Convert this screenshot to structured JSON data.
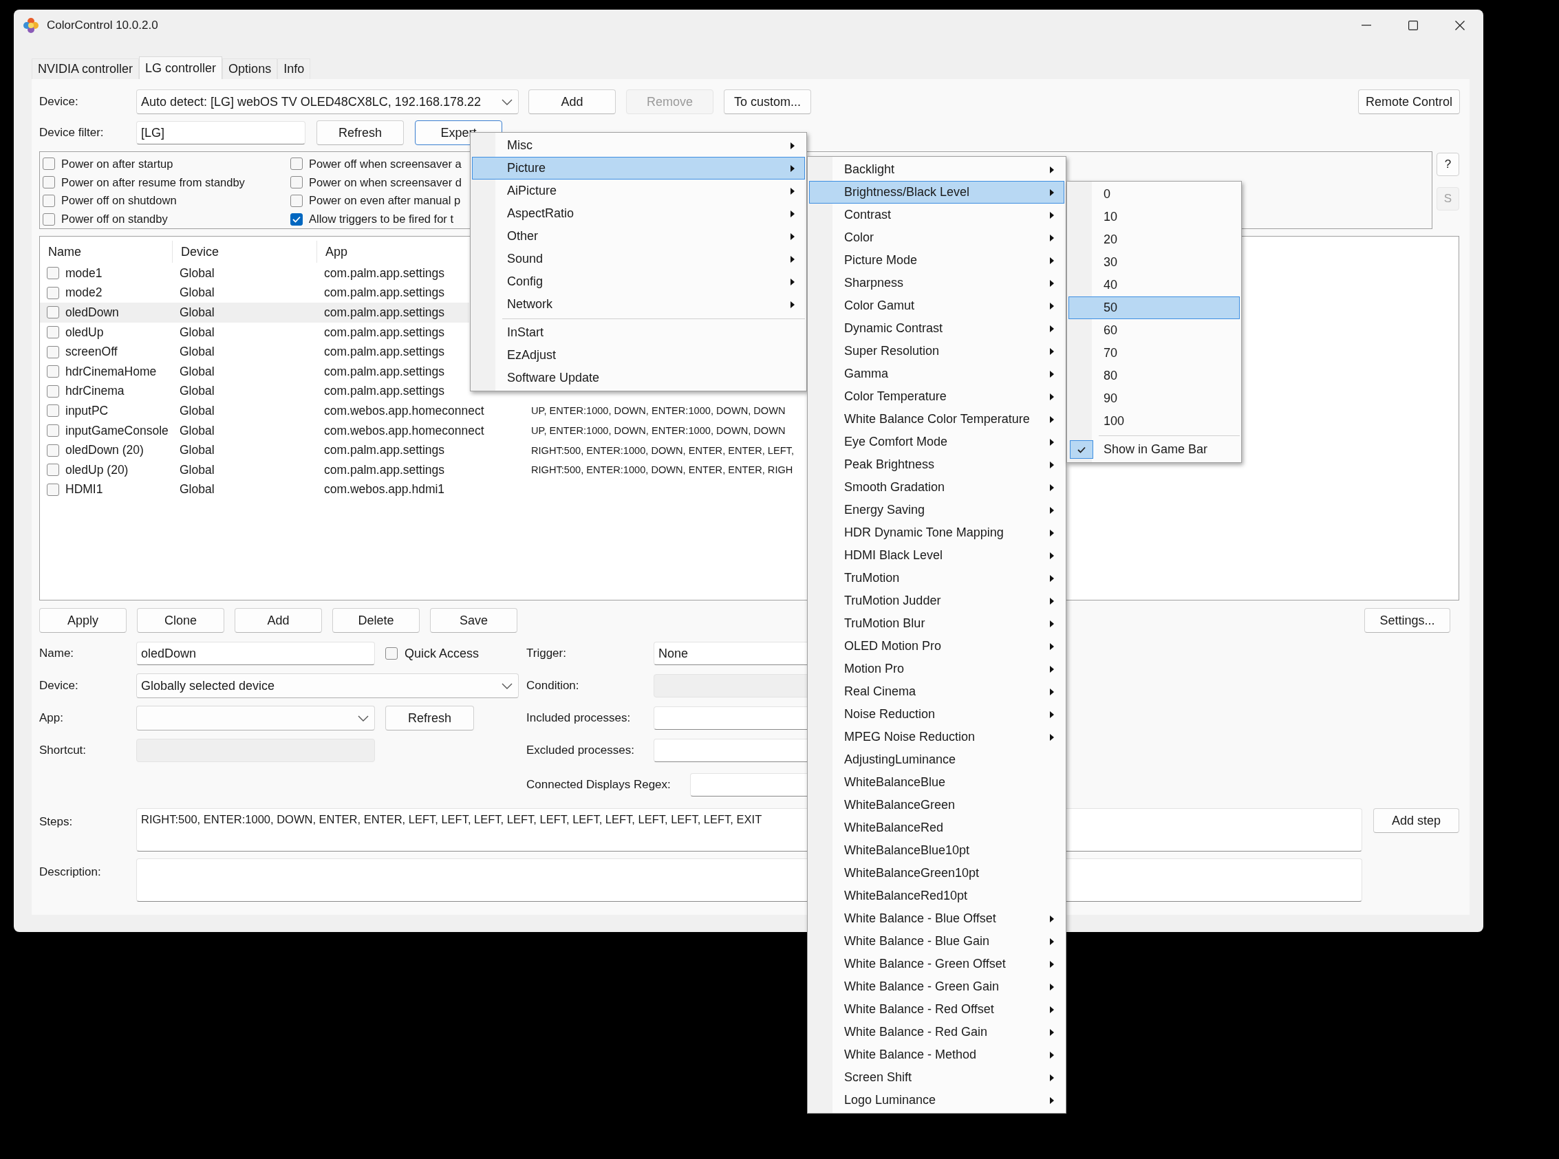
{
  "window": {
    "title": "ColorControl 10.0.2.0"
  },
  "tabs": [
    {
      "label": "NVIDIA controller",
      "selected": false
    },
    {
      "label": "LG controller",
      "selected": true
    },
    {
      "label": "Options",
      "selected": false
    },
    {
      "label": "Info",
      "selected": false
    }
  ],
  "device_row": {
    "label": "Device:",
    "value": "Auto detect: [LG] webOS TV OLED48CX8LC, 192.168.178.22",
    "buttons": [
      {
        "label": "Add",
        "disabled": false
      },
      {
        "label": "Remove",
        "disabled": true
      },
      {
        "label": "To custom...",
        "disabled": false
      }
    ],
    "remote_button": "Remote Control"
  },
  "filter_row": {
    "label": "Device filter:",
    "value": "[LG]",
    "buttons": [
      {
        "label": "Refresh",
        "focused": false
      },
      {
        "label": "Expert",
        "focused": true
      }
    ]
  },
  "power_columns": [
    {
      "options": [
        {
          "label": "Power on after startup",
          "checked": false
        },
        {
          "label": "Power on after resume from standby",
          "checked": false
        },
        {
          "label": "Power off on shutdown",
          "checked": false
        },
        {
          "label": "Power off on standby",
          "checked": false
        }
      ]
    },
    {
      "options": [
        {
          "label": "Power off when screensaver a",
          "checked": false
        },
        {
          "label": "Power on when screensaver d",
          "checked": false
        },
        {
          "label": "Power on even after manual p",
          "checked": false
        },
        {
          "label": "Allow triggers to be fired for t",
          "checked": true
        }
      ]
    }
  ],
  "side_buttons": [
    {
      "label": "?",
      "disabled": false
    },
    {
      "label": "S",
      "disabled": true
    }
  ],
  "table": {
    "columns": [
      "Name",
      "Device",
      "App"
    ],
    "rows": [
      {
        "name": "mode1",
        "checked": false,
        "selected": false,
        "device": "Global",
        "app": "com.palm.app.settings"
      },
      {
        "name": "mode2",
        "checked": false,
        "selected": false,
        "device": "Global",
        "app": "com.palm.app.settings"
      },
      {
        "name": "oledDown",
        "checked": false,
        "selected": true,
        "device": "Global",
        "app": "com.palm.app.settings"
      },
      {
        "name": "oledUp",
        "checked": false,
        "selected": false,
        "device": "Global",
        "app": "com.palm.app.settings"
      },
      {
        "name": "screenOff",
        "checked": false,
        "selected": false,
        "device": "Global",
        "app": "com.palm.app.settings"
      },
      {
        "name": "hdrCinemaHome",
        "checked": false,
        "selected": false,
        "device": "Global",
        "app": "com.palm.app.settings"
      },
      {
        "name": "hdrCinema",
        "checked": false,
        "selected": false,
        "device": "Global",
        "app": "com.palm.app.settings"
      },
      {
        "name": "inputPC",
        "checked": false,
        "selected": false,
        "device": "Global",
        "app": "com.webos.app.homeconnect",
        "steps": "UP, ENTER:1000, DOWN, ENTER:1000, DOWN, DOWN"
      },
      {
        "name": "inputGameConsole",
        "checked": false,
        "selected": false,
        "device": "Global",
        "app": "com.webos.app.homeconnect",
        "steps": "UP, ENTER:1000, DOWN, ENTER:1000, DOWN, DOWN"
      },
      {
        "name": "oledDown (20)",
        "checked": false,
        "selected": false,
        "device": "Global",
        "app": "com.palm.app.settings",
        "steps": "RIGHT:500, ENTER:1000, DOWN, ENTER, ENTER, LEFT,"
      },
      {
        "name": "oledUp (20)",
        "checked": false,
        "selected": false,
        "device": "Global",
        "app": "com.palm.app.settings",
        "steps": "RIGHT:500, ENTER:1000, DOWN, ENTER, ENTER, RIGH"
      },
      {
        "name": "HDMI1",
        "checked": false,
        "selected": false,
        "device": "Global",
        "app": "com.webos.app.hdmi1"
      }
    ]
  },
  "action_buttons": [
    "Apply",
    "Clone",
    "Add",
    "Delete",
    "Save"
  ],
  "settings_button": "Settings...",
  "form": {
    "name": {
      "label": "Name:",
      "value": "oledDown"
    },
    "quick_access": {
      "label": "Quick Access",
      "checked": false
    },
    "device": {
      "label": "Device:",
      "value": "Globally selected device"
    },
    "app": {
      "label": "App:"
    },
    "app_refresh": "Refresh",
    "shortcut": {
      "label": "Shortcut:",
      "disabled": true
    },
    "trigger": {
      "label": "Trigger:",
      "value": "None",
      "disabled": false
    },
    "condition": {
      "label": "Condition:",
      "disabled": true
    },
    "included": {
      "label": "Included processes:",
      "disabled": false
    },
    "excluded": {
      "label": "Excluded processes:",
      "disabled": false
    },
    "displays_regex": {
      "label": "Connected Displays Regex:",
      "disabled": false
    },
    "steps": {
      "label": "Steps:",
      "value": "RIGHT:500, ENTER:1000, DOWN, ENTER, ENTER, LEFT, LEFT, LEFT, LEFT, LEFT, LEFT, LEFT, LEFT, LEFT, LEFT, EXIT"
    },
    "add_step": "Add step",
    "description": {
      "label": "Description:"
    }
  },
  "menus": [
    {
      "items": [
        {
          "kind": "item",
          "label": "Misc",
          "submenu": true,
          "selected": false
        },
        {
          "kind": "item",
          "label": "Picture",
          "submenu": true,
          "selected": true
        },
        {
          "kind": "item",
          "label": "AiPicture",
          "submenu": true,
          "selected": false
        },
        {
          "kind": "item",
          "label": "AspectRatio",
          "submenu": true,
          "selected": false
        },
        {
          "kind": "item",
          "label": "Other",
          "submenu": true,
          "selected": false
        },
        {
          "kind": "item",
          "label": "Sound",
          "submenu": true,
          "selected": false
        },
        {
          "kind": "item",
          "label": "Config",
          "submenu": true,
          "selected": false
        },
        {
          "kind": "item",
          "label": "Network",
          "submenu": true,
          "selected": false
        },
        {
          "kind": "separator"
        },
        {
          "kind": "item",
          "label": "InStart",
          "submenu": false,
          "selected": false
        },
        {
          "kind": "item",
          "label": "EzAdjust",
          "submenu": false,
          "selected": false
        },
        {
          "kind": "item",
          "label": "Software Update",
          "submenu": false,
          "selected": false
        }
      ]
    },
    {
      "items": [
        {
          "kind": "item",
          "label": "Backlight",
          "submenu": true,
          "selected": false
        },
        {
          "kind": "item",
          "label": "Brightness/Black Level",
          "submenu": true,
          "selected": true
        },
        {
          "kind": "item",
          "label": "Contrast",
          "submenu": true,
          "selected": false
        },
        {
          "kind": "item",
          "label": "Color",
          "submenu": true,
          "selected": false
        },
        {
          "kind": "item",
          "label": "Picture Mode",
          "submenu": true,
          "selected": false
        },
        {
          "kind": "item",
          "label": "Sharpness",
          "submenu": true,
          "selected": false
        },
        {
          "kind": "item",
          "label": "Color Gamut",
          "submenu": true,
          "selected": false
        },
        {
          "kind": "item",
          "label": "Dynamic Contrast",
          "submenu": true,
          "selected": false
        },
        {
          "kind": "item",
          "label": "Super Resolution",
          "submenu": true,
          "selected": false
        },
        {
          "kind": "item",
          "label": "Gamma",
          "submenu": true,
          "selected": false
        },
        {
          "kind": "item",
          "label": "Color Temperature",
          "submenu": true,
          "selected": false
        },
        {
          "kind": "item",
          "label": "White Balance Color Temperature",
          "submenu": true,
          "selected": false
        },
        {
          "kind": "item",
          "label": "Eye Comfort Mode",
          "submenu": true,
          "selected": false
        },
        {
          "kind": "item",
          "label": "Peak Brightness",
          "submenu": true,
          "selected": false
        },
        {
          "kind": "item",
          "label": "Smooth Gradation",
          "submenu": true,
          "selected": false
        },
        {
          "kind": "item",
          "label": "Energy Saving",
          "submenu": true,
          "selected": false
        },
        {
          "kind": "item",
          "label": "HDR Dynamic Tone Mapping",
          "submenu": true,
          "selected": false
        },
        {
          "kind": "item",
          "label": "HDMI Black Level",
          "submenu": true,
          "selected": false
        },
        {
          "kind": "item",
          "label": "TruMotion",
          "submenu": true,
          "selected": false
        },
        {
          "kind": "item",
          "label": "TruMotion Judder",
          "submenu": true,
          "selected": false
        },
        {
          "kind": "item",
          "label": "TruMotion Blur",
          "submenu": true,
          "selected": false
        },
        {
          "kind": "item",
          "label": "OLED Motion Pro",
          "submenu": true,
          "selected": false
        },
        {
          "kind": "item",
          "label": "Motion Pro",
          "submenu": true,
          "selected": false
        },
        {
          "kind": "item",
          "label": "Real Cinema",
          "submenu": true,
          "selected": false
        },
        {
          "kind": "item",
          "label": "Noise Reduction",
          "submenu": true,
          "selected": false
        },
        {
          "kind": "item",
          "label": "MPEG Noise Reduction",
          "submenu": true,
          "selected": false
        },
        {
          "kind": "item",
          "label": "AdjustingLuminance",
          "submenu": false,
          "selected": false
        },
        {
          "kind": "item",
          "label": "WhiteBalanceBlue",
          "submenu": false,
          "selected": false
        },
        {
          "kind": "item",
          "label": "WhiteBalanceGreen",
          "submenu": false,
          "selected": false
        },
        {
          "kind": "item",
          "label": "WhiteBalanceRed",
          "submenu": false,
          "selected": false
        },
        {
          "kind": "item",
          "label": "WhiteBalanceBlue10pt",
          "submenu": false,
          "selected": false
        },
        {
          "kind": "item",
          "label": "WhiteBalanceGreen10pt",
          "submenu": false,
          "selected": false
        },
        {
          "kind": "item",
          "label": "WhiteBalanceRed10pt",
          "submenu": false,
          "selected": false
        },
        {
          "kind": "item",
          "label": "White Balance - Blue Offset",
          "submenu": true,
          "selected": false
        },
        {
          "kind": "item",
          "label": "White Balance - Blue Gain",
          "submenu": true,
          "selected": false
        },
        {
          "kind": "item",
          "label": "White Balance - Green Offset",
          "submenu": true,
          "selected": false
        },
        {
          "kind": "item",
          "label": "White Balance - Green Gain",
          "submenu": true,
          "selected": false
        },
        {
          "kind": "item",
          "label": "White Balance - Red Offset",
          "submenu": true,
          "selected": false
        },
        {
          "kind": "item",
          "label": "White Balance - Red Gain",
          "submenu": true,
          "selected": false
        },
        {
          "kind": "item",
          "label": "White Balance - Method",
          "submenu": true,
          "selected": false
        },
        {
          "kind": "item",
          "label": "Screen Shift",
          "submenu": true,
          "selected": false
        },
        {
          "kind": "item",
          "label": "Logo Luminance",
          "submenu": true,
          "selected": false
        }
      ]
    },
    {
      "items": [
        {
          "kind": "item",
          "label": "0",
          "submenu": false,
          "selected": false
        },
        {
          "kind": "item",
          "label": "10",
          "submenu": false,
          "selected": false
        },
        {
          "kind": "item",
          "label": "20",
          "submenu": false,
          "selected": false
        },
        {
          "kind": "item",
          "label": "30",
          "submenu": false,
          "selected": false
        },
        {
          "kind": "item",
          "label": "40",
          "submenu": false,
          "selected": false
        },
        {
          "kind": "item",
          "label": "50",
          "submenu": false,
          "selected": true
        },
        {
          "kind": "item",
          "label": "60",
          "submenu": false,
          "selected": false
        },
        {
          "kind": "item",
          "label": "70",
          "submenu": false,
          "selected": false
        },
        {
          "kind": "item",
          "label": "80",
          "submenu": false,
          "selected": false
        },
        {
          "kind": "item",
          "label": "90",
          "submenu": false,
          "selected": false
        },
        {
          "kind": "item",
          "label": "100",
          "submenu": false,
          "selected": false
        },
        {
          "kind": "separator"
        },
        {
          "kind": "check",
          "label": "Show in Game Bar",
          "checked": true,
          "selected": false
        }
      ]
    }
  ]
}
